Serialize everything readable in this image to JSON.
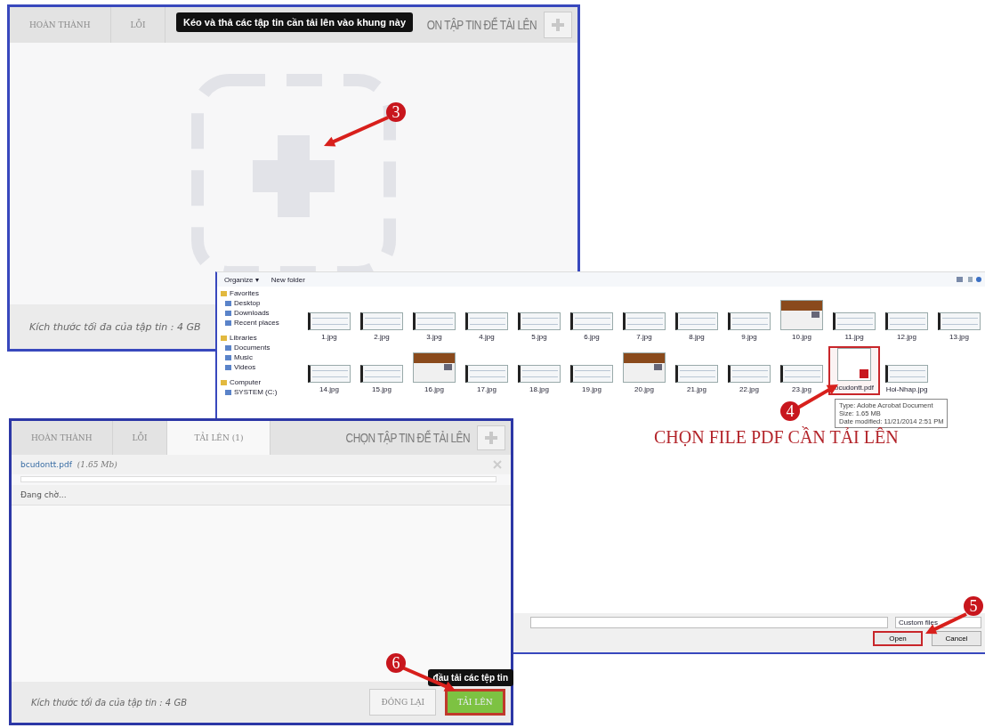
{
  "upload_top": {
    "tabs": [
      {
        "label": "HOÀN THÀNH",
        "selected": false
      },
      {
        "label": "LỖI",
        "selected": false
      }
    ],
    "choose_label": "ON TẬP TIN ĐỂ TẢI LÊN",
    "tooltip": "Kéo và thả các tập tin cần tải lên vào khung này",
    "footer": "Kích thước tối đa của tập tin : 4 GB"
  },
  "file_dialog": {
    "toolbar": [
      "Organize ▾",
      "New folder"
    ],
    "sidebar": [
      {
        "label": "Favorites",
        "children": [
          {
            "label": "Desktop"
          },
          {
            "label": "Downloads"
          },
          {
            "label": "Recent places"
          }
        ]
      },
      {
        "label": "Libraries",
        "children": [
          {
            "label": "Documents"
          },
          {
            "label": "Music"
          },
          {
            "label": "Videos"
          }
        ]
      },
      {
        "label": "Computer",
        "children": [
          {
            "label": "SYSTEM (C:)"
          }
        ]
      }
    ],
    "files": [
      {
        "name": "1.jpg",
        "kind": "screenshot",
        "selected": false
      },
      {
        "name": "2.jpg",
        "kind": "screenshot",
        "selected": false
      },
      {
        "name": "3.jpg",
        "kind": "screenshot",
        "selected": false
      },
      {
        "name": "4.jpg",
        "kind": "screenshot",
        "selected": false
      },
      {
        "name": "5.jpg",
        "kind": "screenshot",
        "selected": false
      },
      {
        "name": "6.jpg",
        "kind": "screenshot",
        "selected": false
      },
      {
        "name": "7.jpg",
        "kind": "screenshot",
        "selected": false
      },
      {
        "name": "8.jpg",
        "kind": "screenshot",
        "selected": false
      },
      {
        "name": "9.jpg",
        "kind": "screenshot",
        "selected": false
      },
      {
        "name": "10.jpg",
        "kind": "photo",
        "selected": false
      },
      {
        "name": "11.jpg",
        "kind": "screenshot",
        "selected": false
      },
      {
        "name": "12.jpg",
        "kind": "screenshot",
        "selected": false
      },
      {
        "name": "13.jpg",
        "kind": "screenshot",
        "selected": false
      },
      {
        "name": "14.jpg",
        "kind": "screenshot",
        "selected": false
      },
      {
        "name": "15.jpg",
        "kind": "screenshot",
        "selected": false
      },
      {
        "name": "16.jpg",
        "kind": "photo",
        "selected": false
      },
      {
        "name": "17.jpg",
        "kind": "screenshot",
        "selected": false
      },
      {
        "name": "18.jpg",
        "kind": "screenshot",
        "selected": false
      },
      {
        "name": "19.jpg",
        "kind": "screenshot",
        "selected": false
      },
      {
        "name": "20.jpg",
        "kind": "photo",
        "selected": false
      },
      {
        "name": "21.jpg",
        "kind": "screenshot",
        "selected": false
      },
      {
        "name": "22.jpg",
        "kind": "screenshot",
        "selected": false
      },
      {
        "name": "23.jpg",
        "kind": "screenshot",
        "selected": false
      },
      {
        "name": "bcudontt.pdf",
        "kind": "pdf",
        "selected": true
      },
      {
        "name": "Hoi-Nhap.jpg",
        "kind": "screenshot",
        "selected": false
      }
    ],
    "file_tooltip": [
      "Type: Adobe Acrobat Document",
      "Size: 1.65 MB",
      "Date modified: 11/21/2014 2:51 PM"
    ],
    "file_type": "Custom files",
    "buttons": [
      {
        "label": "Open",
        "highlighted": true
      },
      {
        "label": "Cancel",
        "highlighted": false
      }
    ]
  },
  "upload_bottom": {
    "tabs": [
      {
        "label": "HOÀN THÀNH",
        "selected": false
      },
      {
        "label": "LỖI",
        "selected": false
      },
      {
        "label": "TẢI LÊN (1)",
        "selected": true
      }
    ],
    "choose_label": "CHỌN TẬP TIN ĐỂ TẢI LÊN",
    "file": {
      "name": "bcudontt.pdf",
      "size": "(1.65 Mb)",
      "level": 0,
      "status": "Đang chờ..."
    },
    "footer": "Kích thước tối đa của tập tin : 4 GB",
    "tooltip": "đầu tải các tệp tin",
    "buttons": [
      {
        "label": "ĐÓNG LẠI",
        "kind": "secondary",
        "highlighted": false
      },
      {
        "label": "TẢI LÊN",
        "kind": "primary",
        "highlighted": true
      }
    ]
  },
  "caption": "CHỌN FILE PDF CẦN TẢI LÊN",
  "steps": [
    "3",
    "4",
    "5",
    "6"
  ]
}
